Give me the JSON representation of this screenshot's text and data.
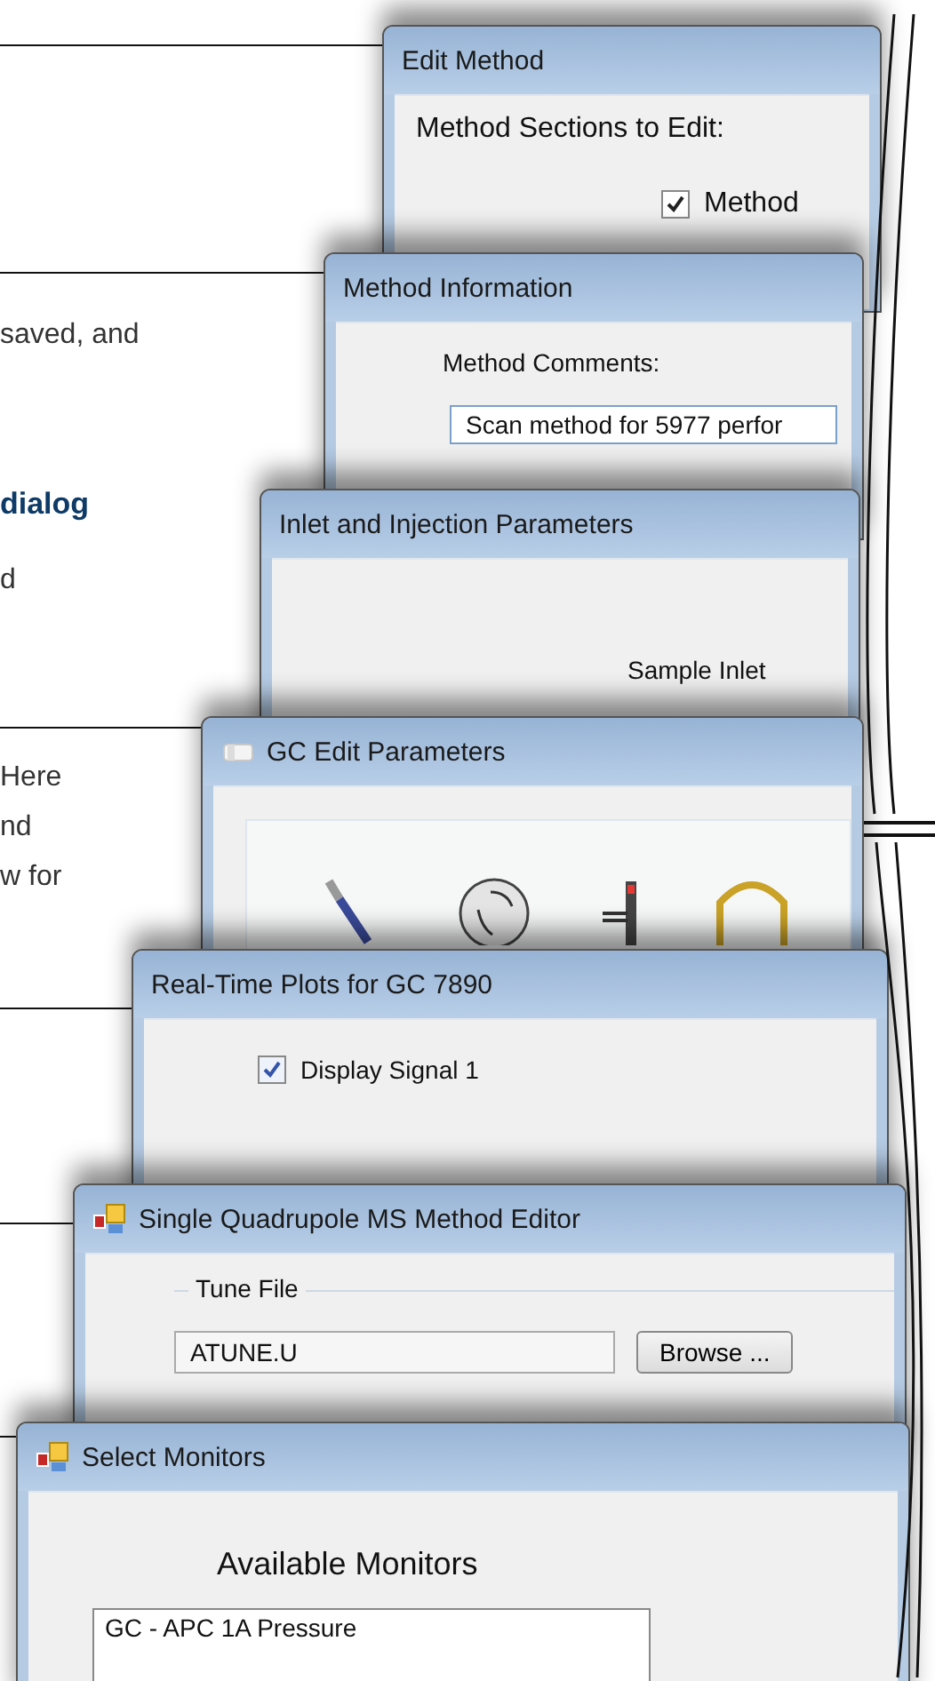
{
  "callouts": [
    {
      "kind": "plain",
      "text": "saved, and"
    },
    {
      "kind": "heading",
      "text": "dialog"
    },
    {
      "kind": "plain",
      "text": "d"
    },
    {
      "kind": "plain",
      "text": "Here"
    },
    {
      "kind": "plain",
      "text": "nd"
    },
    {
      "kind": "plain",
      "text": "w for"
    }
  ],
  "windows": [
    {
      "kind": "sections",
      "title": "Edit Method",
      "label": "Method Sections to Edit:",
      "checkbox": {
        "label": "Method",
        "checked": true
      }
    },
    {
      "kind": "comments",
      "title": "Method Information",
      "label": "Method Comments:",
      "value": "Scan method for 5977 perfor"
    },
    {
      "kind": "inlet",
      "title": "Inlet and Injection Parameters",
      "label": "Sample Inlet"
    },
    {
      "kind": "gc",
      "title": "GC Edit Parameters"
    },
    {
      "kind": "plots",
      "title": "Real-Time Plots for GC 7890",
      "checkbox": {
        "label": "Display Signal 1",
        "checked": true
      }
    },
    {
      "kind": "ms",
      "title": "Single Quadrupole MS Method Editor",
      "group": "Tune File",
      "value": "ATUNE.U",
      "button": "Browse ..."
    },
    {
      "kind": "monitors",
      "title": "Select Monitors",
      "heading": "Available Monitors",
      "list_item": "GC - APC 1A Pressure"
    }
  ]
}
